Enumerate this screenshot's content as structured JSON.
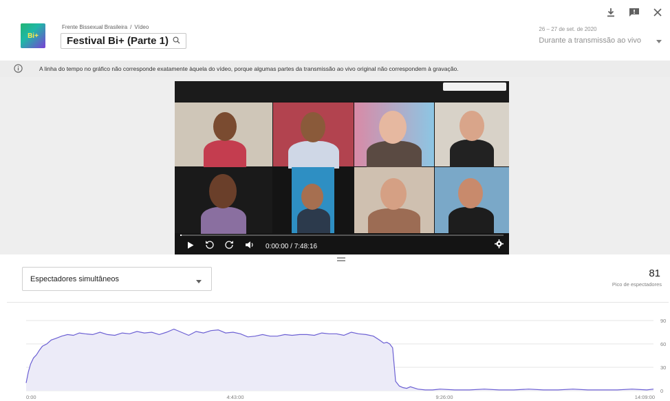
{
  "header": {
    "channel": "Frente Bissexual Brasileira",
    "separator": "/",
    "section": "Vídeo",
    "video_title": "Festival Bi+ (Parte 1)",
    "logo_text": "Bi+",
    "date_range": "26 – 27 de set. de 2020",
    "period_label": "Durante a transmissão ao vivo",
    "icons": [
      "download-icon",
      "feedback-icon",
      "close-icon",
      "search-icon",
      "caret-down-icon"
    ]
  },
  "info": {
    "message": "A linha do tempo no gráfico não corresponde exatamente àquela do vídeo, porque algumas partes da transmissão ao vivo original não correspondem à gravação.",
    "icon": "info-icon"
  },
  "player": {
    "time": "0:00:00 / 7:48:16",
    "progress_fraction": 0.005,
    "icons": [
      "play-icon",
      "rewind-10-icon",
      "forward-10-icon",
      "volume-icon",
      "settings-icon"
    ]
  },
  "metric": {
    "selected": "Espectadores simultâneos",
    "peak_value": "81",
    "peak_label": "Pico de espectadores"
  },
  "chart_data": {
    "type": "area",
    "title": "",
    "xlabel": "",
    "ylabel": "",
    "x_ticks": [
      "0:00",
      "4:43:00",
      "9:26:00",
      "14:09:00"
    ],
    "y_ticks": [
      0,
      30,
      60,
      90
    ],
    "ylim": [
      0,
      90
    ],
    "xlim_minutes": [
      0,
      849
    ],
    "color": "#6b5fd3",
    "fill": "#ecebf8",
    "series": [
      {
        "x_minutes": [
          0,
          3,
          6,
          10,
          14,
          18,
          22,
          28,
          34,
          40,
          48,
          56,
          64,
          72,
          80,
          90,
          100,
          110,
          120,
          130,
          140,
          150,
          160,
          170,
          180,
          190,
          200,
          210,
          220,
          230,
          240,
          250,
          260,
          270,
          280,
          290,
          300,
          310,
          320,
          330,
          340,
          350,
          360,
          370,
          380,
          390,
          400,
          410,
          420,
          430,
          440,
          450,
          460,
          470,
          478,
          484,
          488,
          492,
          496,
          500,
          505,
          510,
          515,
          520,
          530,
          540,
          550,
          560,
          580,
          600,
          620,
          640,
          660,
          680,
          700,
          720,
          740,
          760,
          780,
          800,
          820,
          840,
          849
        ],
        "values": [
          10,
          24,
          34,
          42,
          46,
          52,
          57,
          60,
          65,
          67,
          70,
          72,
          71,
          74,
          73,
          72,
          75,
          72,
          71,
          74,
          73,
          76,
          74,
          75,
          72,
          75,
          79,
          75,
          71,
          76,
          74,
          77,
          78,
          74,
          75,
          73,
          69,
          70,
          72,
          70,
          70,
          72,
          71,
          72,
          72,
          71,
          74,
          73,
          73,
          71,
          75,
          73,
          72,
          70,
          65,
          61,
          62,
          60,
          55,
          12,
          6,
          4,
          3,
          5,
          2,
          1,
          1,
          2,
          1,
          1,
          2,
          1,
          1,
          2,
          1,
          1,
          2,
          1,
          1,
          1,
          2,
          1,
          2
        ]
      }
    ]
  }
}
